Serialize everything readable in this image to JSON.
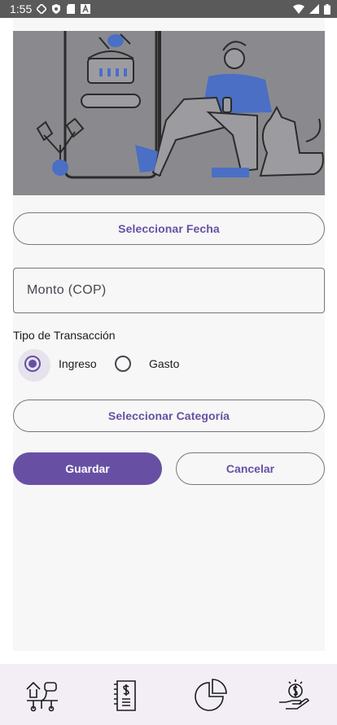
{
  "status_bar": {
    "time": "1:55"
  },
  "form": {
    "date_button_label": "Seleccionar Fecha",
    "amount_placeholder": "Monto (COP)",
    "transaction_type_label": "Tipo de Transacción",
    "transaction_types": [
      {
        "label": "Ingreso",
        "selected": true
      },
      {
        "label": "Gasto",
        "selected": false
      }
    ],
    "category_button_label": "Seleccionar Categoría",
    "save_label": "Guardar",
    "cancel_label": "Cancelar"
  },
  "bottom_nav": {
    "items": [
      {
        "icon": "transfer-icon"
      },
      {
        "icon": "report-icon"
      },
      {
        "icon": "pie-chart-icon"
      },
      {
        "icon": "savings-icon"
      }
    ]
  },
  "colors": {
    "primary": "#6750a4",
    "outline": "#79747e",
    "hero_bg": "#8a8a8e",
    "illustration_accent": "#4a6fc4"
  }
}
